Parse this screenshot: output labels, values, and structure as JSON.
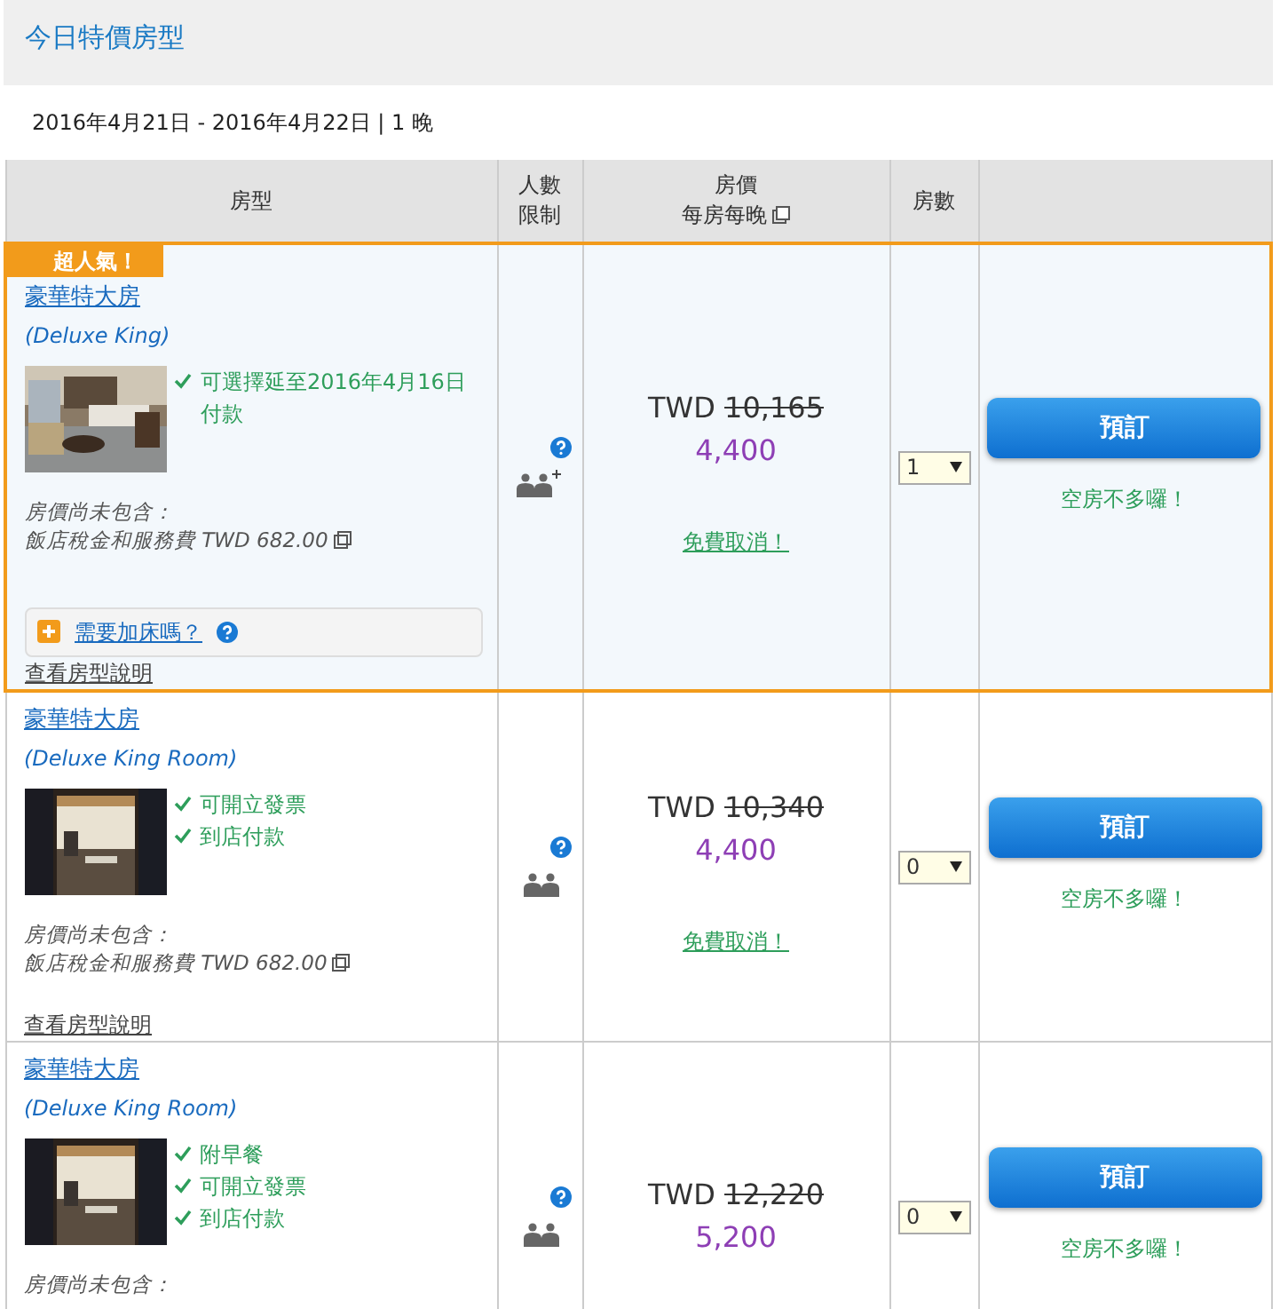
{
  "section_title": "今日特價房型",
  "stay": "2016年4月21日 - 2016年4月22日 | 1 晚",
  "columns": [
    {
      "lines": [
        "房型"
      ]
    },
    {
      "lines": [
        "人數",
        "限制"
      ]
    },
    {
      "lines": [
        "房價",
        "每房每晚"
      ],
      "popup": true
    },
    {
      "lines": [
        "房數"
      ]
    }
  ],
  "rooms": [
    {
      "featured": true,
      "badge": "超人氣！",
      "name": "豪華特大房",
      "name_en": "(Deluxe King)",
      "features": [
        "可選擇延至2016年4月16日付款"
      ],
      "tax_label": "房價尚未包含：",
      "tax_text": "飯店稅金和服務費 TWD 682.00",
      "extra_bed": "需要加床嗎？",
      "details_link": "查看房型說明",
      "extra_guest": true,
      "currency": "TWD",
      "original_price": "10,165",
      "price": "4,400",
      "free_cancel": "免費取消！",
      "rooms_selected": "1",
      "book_label": "預訂",
      "availability": "空房不多囉！"
    },
    {
      "featured": false,
      "name": "豪華特大房",
      "name_en": "(Deluxe King Room)",
      "features": [
        "可開立發票",
        "到店付款"
      ],
      "tax_label": "房價尚未包含：",
      "tax_text": "飯店稅金和服務費 TWD 682.00",
      "details_link": "查看房型說明",
      "extra_guest": false,
      "currency": "TWD",
      "original_price": "10,340",
      "price": "4,400",
      "free_cancel": "免費取消！",
      "rooms_selected": "0",
      "book_label": "預訂",
      "availability": "空房不多囉！"
    },
    {
      "featured": false,
      "name": "豪華特大房",
      "name_en": "(Deluxe King Room)",
      "features": [
        "附早餐",
        "可開立發票",
        "到店付款"
      ],
      "tax_label": "房價尚未包含：",
      "extra_guest": false,
      "currency": "TWD",
      "original_price": "12,220",
      "price": "5,200",
      "rooms_selected": "0",
      "book_label": "預訂",
      "availability": "空房不多囉！"
    }
  ]
}
